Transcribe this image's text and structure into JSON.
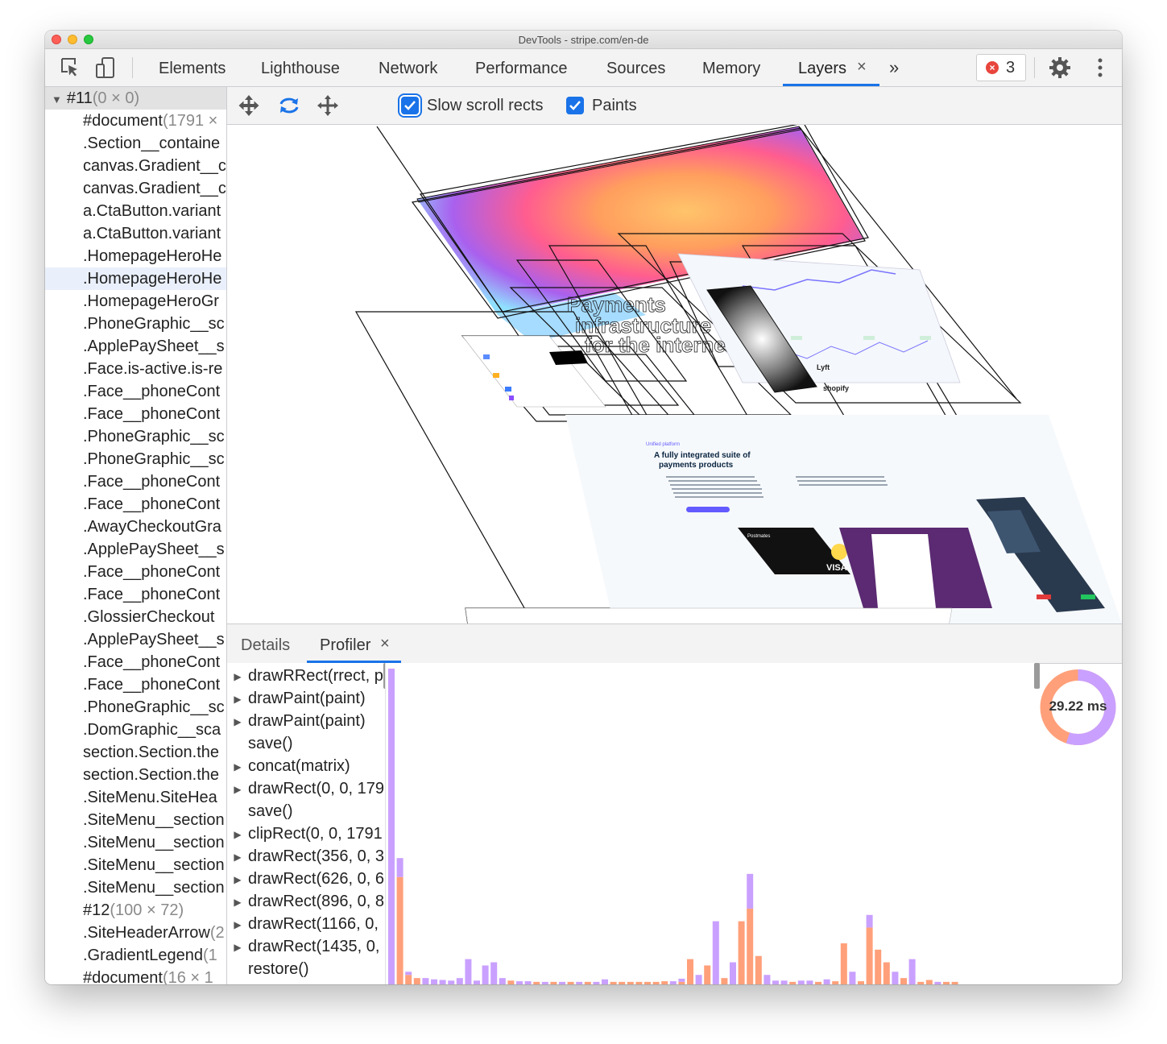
{
  "window": {
    "title": "DevTools - stripe.com/en-de"
  },
  "tabs": [
    {
      "label": "Elements"
    },
    {
      "label": "Lighthouse"
    },
    {
      "label": "Network"
    },
    {
      "label": "Performance"
    },
    {
      "label": "Sources"
    },
    {
      "label": "Memory"
    },
    {
      "label": "Layers",
      "active": true,
      "closable": true
    }
  ],
  "toolbar": {
    "more_tabs": "»",
    "close_glyph": "×",
    "error_count": "3"
  },
  "layer_tree": [
    {
      "name": "#11",
      "size": "(0 × 0)",
      "root": true
    },
    {
      "name": "#document",
      "size": "(1791 ×"
    },
    {
      "name": ".Section__containe",
      "size": ""
    },
    {
      "name": "canvas.Gradient__c",
      "size": ""
    },
    {
      "name": "canvas.Gradient__c",
      "size": ""
    },
    {
      "name": "a.CtaButton.variant",
      "size": ""
    },
    {
      "name": "a.CtaButton.variant",
      "size": ""
    },
    {
      "name": ".HomepageHeroHe",
      "size": ""
    },
    {
      "name": ".HomepageHeroHe",
      "size": "",
      "hovered": true
    },
    {
      "name": ".HomepageHeroGr",
      "size": ""
    },
    {
      "name": ".PhoneGraphic__sc",
      "size": ""
    },
    {
      "name": ".ApplePaySheet__s",
      "size": ""
    },
    {
      "name": ".Face.is-active.is-re",
      "size": ""
    },
    {
      "name": ".Face__phoneCont",
      "size": ""
    },
    {
      "name": ".Face__phoneCont",
      "size": ""
    },
    {
      "name": ".PhoneGraphic__sc",
      "size": ""
    },
    {
      "name": ".PhoneGraphic__sc",
      "size": ""
    },
    {
      "name": ".Face__phoneCont",
      "size": ""
    },
    {
      "name": ".Face__phoneCont",
      "size": ""
    },
    {
      "name": ".AwayCheckoutGra",
      "size": ""
    },
    {
      "name": ".ApplePaySheet__s",
      "size": ""
    },
    {
      "name": ".Face__phoneCont",
      "size": ""
    },
    {
      "name": ".Face__phoneCont",
      "size": ""
    },
    {
      "name": ".GlossierCheckout",
      "size": ""
    },
    {
      "name": ".ApplePaySheet__s",
      "size": ""
    },
    {
      "name": ".Face__phoneCont",
      "size": ""
    },
    {
      "name": ".Face__phoneCont",
      "size": ""
    },
    {
      "name": ".PhoneGraphic__sc",
      "size": ""
    },
    {
      "name": ".DomGraphic__sca",
      "size": ""
    },
    {
      "name": "section.Section.the",
      "size": ""
    },
    {
      "name": "section.Section.the",
      "size": ""
    },
    {
      "name": ".SiteMenu.SiteHea",
      "size": ""
    },
    {
      "name": ".SiteMenu__section",
      "size": ""
    },
    {
      "name": ".SiteMenu__section",
      "size": ""
    },
    {
      "name": ".SiteMenu__section",
      "size": ""
    },
    {
      "name": ".SiteMenu__section",
      "size": ""
    },
    {
      "name": "#12",
      "size": "(100 × 72)"
    },
    {
      "name": ".SiteHeaderArrow",
      "size": "(2"
    },
    {
      "name": ".GradientLegend",
      "size": "(1"
    },
    {
      "name": "#document",
      "size": "(16 × 1"
    }
  ],
  "layers_toolbar": {
    "slow_scroll_label": "Slow scroll rects",
    "paints_label": "Paints"
  },
  "viewport_text": {
    "hero": [
      "Payments",
      "infrastructure",
      "for the interne"
    ],
    "section_tag": "Unified platform",
    "section_title_1": "A fully integrated suite of",
    "section_title_2": "payments products",
    "card_brand": "Postmates",
    "card_network": "VISA",
    "logo_1": "shopify",
    "logo_2": "Lyft"
  },
  "bottom_tabs": [
    {
      "label": "Details"
    },
    {
      "label": "Profiler",
      "active": true,
      "closable": true
    }
  ],
  "commands": [
    {
      "label": "drawRRect(rrect, p",
      "expandable": true
    },
    {
      "label": "drawPaint(paint)",
      "expandable": true
    },
    {
      "label": "drawPaint(paint)",
      "expandable": true
    },
    {
      "label": "save()",
      "expandable": false
    },
    {
      "label": "concat(matrix)",
      "expandable": true
    },
    {
      "label": "drawRect(0, 0, 179",
      "expandable": true
    },
    {
      "label": "save()",
      "expandable": false
    },
    {
      "label": "clipRect(0, 0, 1791",
      "expandable": true
    },
    {
      "label": "drawRect(356, 0, 3",
      "expandable": true
    },
    {
      "label": "drawRect(626, 0, 6",
      "expandable": true
    },
    {
      "label": "drawRect(896, 0, 8",
      "expandable": true
    },
    {
      "label": "drawRect(1166, 0,",
      "expandable": true
    },
    {
      "label": "drawRect(1435, 0,",
      "expandable": true
    },
    {
      "label": "restore()",
      "expandable": false
    }
  ],
  "profiler": {
    "total_label": "29.22 ms",
    "colors": {
      "purple": "#c9a0ff",
      "orange": "#ffa07a"
    },
    "pie_fraction_purple": 0.55,
    "bars": [
      {
        "orange": 0,
        "purple": 100
      },
      {
        "orange": 34,
        "purple": 6
      },
      {
        "orange": 3,
        "purple": 1
      },
      {
        "orange": 2,
        "purple": 0
      },
      {
        "orange": 0,
        "purple": 2
      },
      {
        "orange": 0,
        "purple": 1.6
      },
      {
        "orange": 0,
        "purple": 1.4
      },
      {
        "orange": 0,
        "purple": 1.2
      },
      {
        "orange": 0,
        "purple": 2
      },
      {
        "orange": 0,
        "purple": 8
      },
      {
        "orange": 0,
        "purple": 1.2
      },
      {
        "orange": 0,
        "purple": 6
      },
      {
        "orange": 0,
        "purple": 7
      },
      {
        "orange": 0,
        "purple": 2
      },
      {
        "orange": 1.2,
        "purple": 0
      },
      {
        "orange": 0,
        "purple": 1
      },
      {
        "orange": 0,
        "purple": 1
      },
      {
        "orange": 0.8,
        "purple": 0
      },
      {
        "orange": 0,
        "purple": 0.8
      },
      {
        "orange": 0.8,
        "purple": 0
      },
      {
        "orange": 0,
        "purple": 0.8
      },
      {
        "orange": 0.8,
        "purple": 0
      },
      {
        "orange": 0,
        "purple": 0.8
      },
      {
        "orange": 0.8,
        "purple": 0
      },
      {
        "orange": 0,
        "purple": 0.8
      },
      {
        "orange": 0,
        "purple": 1.6
      },
      {
        "orange": 0.8,
        "purple": 0
      },
      {
        "orange": 0.8,
        "purple": 0
      },
      {
        "orange": 0.8,
        "purple": 0
      },
      {
        "orange": 0.8,
        "purple": 0
      },
      {
        "orange": 0.8,
        "purple": 0
      },
      {
        "orange": 0.8,
        "purple": 0
      },
      {
        "orange": 1,
        "purple": 0
      },
      {
        "orange": 0,
        "purple": 1
      },
      {
        "orange": 0.8,
        "purple": 1
      },
      {
        "orange": 8,
        "purple": 0
      },
      {
        "orange": 0,
        "purple": 3
      },
      {
        "orange": 6,
        "purple": 0
      },
      {
        "orange": 0,
        "purple": 20
      },
      {
        "orange": 2,
        "purple": 0
      },
      {
        "orange": 0,
        "purple": 7
      },
      {
        "orange": 20,
        "purple": 0
      },
      {
        "orange": 24,
        "purple": 11
      },
      {
        "orange": 9,
        "purple": 0
      },
      {
        "orange": 0,
        "purple": 3
      },
      {
        "orange": 0,
        "purple": 1.2
      },
      {
        "orange": 0,
        "purple": 1.2
      },
      {
        "orange": 0.8,
        "purple": 0
      },
      {
        "orange": 0,
        "purple": 1.2
      },
      {
        "orange": 0,
        "purple": 1.2
      },
      {
        "orange": 0.8,
        "purple": 0
      },
      {
        "orange": 0,
        "purple": 1.6
      },
      {
        "orange": 1,
        "purple": 0
      },
      {
        "orange": 13,
        "purple": 0
      },
      {
        "orange": 0,
        "purple": 4
      },
      {
        "orange": 1,
        "purple": 0
      },
      {
        "orange": 18,
        "purple": 4
      },
      {
        "orange": 11,
        "purple": 0
      },
      {
        "orange": 7,
        "purple": 0
      },
      {
        "orange": 0,
        "purple": 4
      },
      {
        "orange": 2,
        "purple": 0
      },
      {
        "orange": 0,
        "purple": 8
      },
      {
        "orange": 0.8,
        "purple": 0
      },
      {
        "orange": 1.4,
        "purple": 0
      },
      {
        "orange": 0,
        "purple": 0.8
      },
      {
        "orange": 0.8,
        "purple": 0
      },
      {
        "orange": 0.8,
        "purple": 0
      },
      {
        "orange": 0,
        "purple": 0
      }
    ]
  }
}
